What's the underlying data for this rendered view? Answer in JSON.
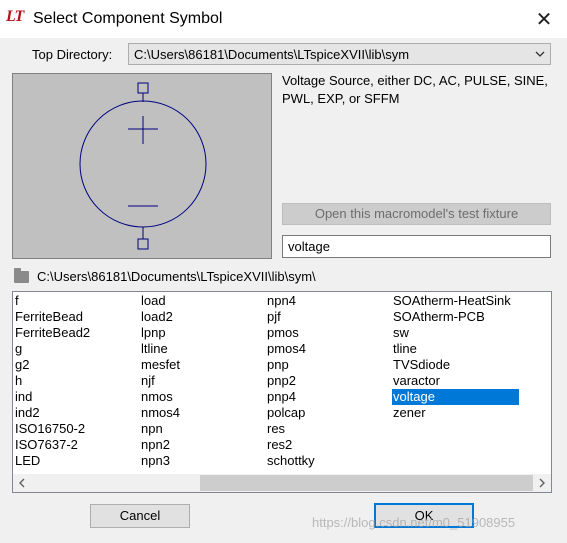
{
  "window": {
    "title": "Select Component Symbol",
    "logo_text": "LT",
    "close_glyph": "✕"
  },
  "top_directory": {
    "label": "Top Directory:",
    "value": "C:\\Users\\86181\\Documents\\LTspiceXVII\\lib\\sym"
  },
  "description": "Voltage Source, either DC, AC, PULSE, SINE, PWL, EXP, or SFFM",
  "test_fixture_button": "Open this macromodel's test fixture",
  "component_name": "voltage",
  "current_path": "C:\\Users\\86181\\Documents\\LTspiceXVII\\lib\\sym\\",
  "columns": [
    [
      "f",
      "FerriteBead",
      "FerriteBead2",
      "g",
      "g2",
      "h",
      "ind",
      "ind2",
      "ISO16750-2",
      "ISO7637-2",
      "LED"
    ],
    [
      "load",
      "load2",
      "lpnp",
      "ltline",
      "mesfet",
      "njf",
      "nmos",
      "nmos4",
      "npn",
      "npn2",
      "npn3"
    ],
    [
      "npn4",
      "pjf",
      "pmos",
      "pmos4",
      "pnp",
      "pnp2",
      "pnp4",
      "polcap",
      "res",
      "res2",
      "schottky"
    ],
    [
      "SOAtherm-HeatSink",
      "SOAtherm-PCB",
      "sw",
      "tline",
      "TVSdiode",
      "varactor",
      "voltage",
      "zener"
    ]
  ],
  "selected_item": "voltage",
  "buttons": {
    "cancel": "Cancel",
    "ok": "OK"
  },
  "watermark": "https://blog.csdn.net/m0_51908955",
  "icons": {
    "folder": "folder-icon",
    "scroll_left": "‹",
    "scroll_right": "›",
    "dropdown": "⌵"
  },
  "colors": {
    "selection": "#0078d7",
    "symbol_stroke": "#000080",
    "preview_bg": "#c0c0c0"
  }
}
